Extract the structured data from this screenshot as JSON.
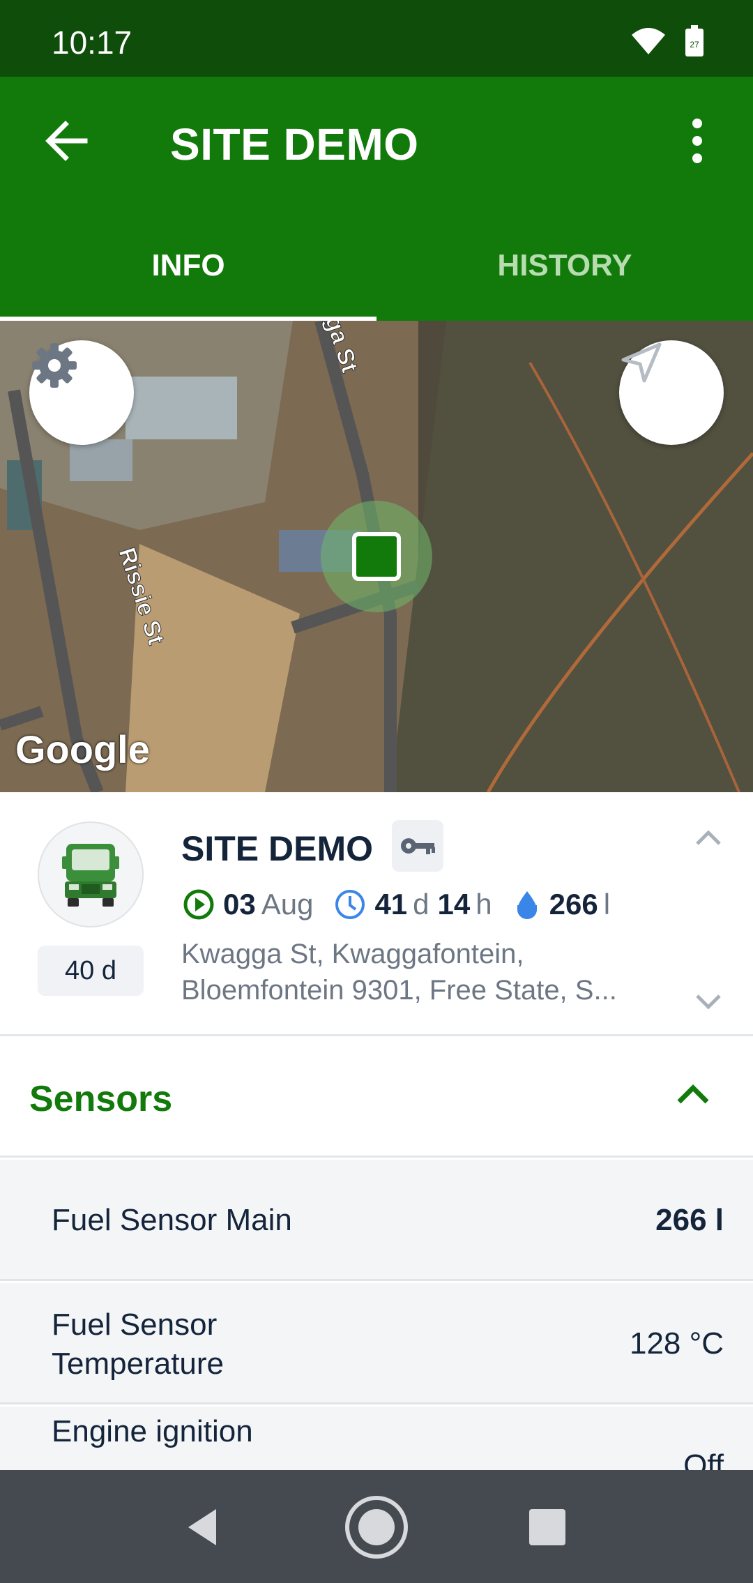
{
  "status_bar": {
    "time": "10:17",
    "battery_level": "27",
    "icons": [
      "wifi-icon",
      "battery-icon"
    ]
  },
  "app_bar": {
    "title": "SITE DEMO",
    "back_icon": "arrow-left-icon",
    "menu_icon": "more-vert-icon"
  },
  "tabs": [
    {
      "label": "INFO",
      "active": true
    },
    {
      "label": "HISTORY",
      "active": false
    }
  ],
  "map": {
    "logo": "Google",
    "labels": {
      "street_1": "Rissie St",
      "street_2": "ga St"
    },
    "buttons": [
      "settings-gear-icon",
      "navigation-arrow-icon"
    ],
    "marker_color": "#117a0a"
  },
  "unit": {
    "name": "SITE DEMO",
    "age": "40 d",
    "stats": {
      "date_value": "03",
      "date_unit": "Aug",
      "duration_days": "41",
      "duration_days_unit": "d",
      "duration_hours": "14",
      "duration_hours_unit": "h",
      "fuel_value": "266",
      "fuel_unit": "l"
    },
    "address_line1": "Kwagga St, Kwaggafontein,",
    "address_line2": "Bloemfontein 9301, Free State, S..."
  },
  "sensors": {
    "title": "Sensors",
    "rows": [
      {
        "name": "Fuel Sensor Main",
        "value": "266 l"
      },
      {
        "name_line1": "Fuel Sensor",
        "name_line2": "Temperature",
        "value": "128 °C"
      },
      {
        "name": "Engine ignition",
        "value": "Off"
      }
    ]
  },
  "colors": {
    "primary": "#117a0a",
    "status_bar": "#0f4d0b",
    "text_dark": "#14243b",
    "text_muted": "#6d7784",
    "accent_blue": "#3a86e8"
  }
}
